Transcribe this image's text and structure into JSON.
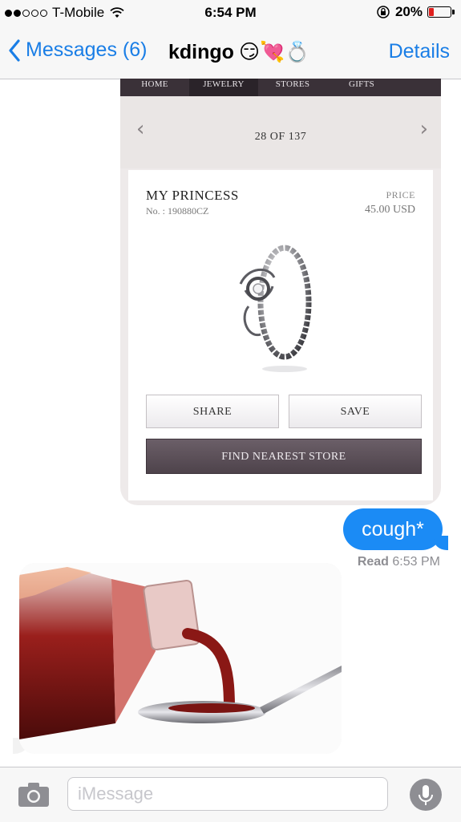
{
  "status": {
    "carrier": "T-Mobile",
    "time": "6:54 PM",
    "battery": "20%",
    "battery_level": 0.2,
    "signal_bars_filled": 2,
    "signal_bars_total": 5
  },
  "nav": {
    "back_label": "Messages (6)",
    "contact": "kdingo",
    "contact_emoji": "😏💘💍",
    "details_label": "Details"
  },
  "screenshot": {
    "tabs": [
      "HOME",
      "JEWELRY",
      "STORES",
      "GIFTS"
    ],
    "active_tab": "JEWELRY",
    "pager": "28 OF 137",
    "product_name": "MY PRINCESS",
    "product_no": "No. : 190880CZ",
    "price_label": "PRICE",
    "price": "45.00 USD",
    "share_label": "SHARE",
    "save_label": "SAVE",
    "store_label": "FIND NEAREST STORE"
  },
  "messages": {
    "outgoing_text": "cough*",
    "read_label": "Read",
    "read_time": "6:53 PM"
  },
  "input": {
    "placeholder": "iMessage"
  },
  "colors": {
    "ios_blue": "#1a7ee6",
    "bubble_blue": "#1b8bf5",
    "battery_red": "#e0201e"
  }
}
